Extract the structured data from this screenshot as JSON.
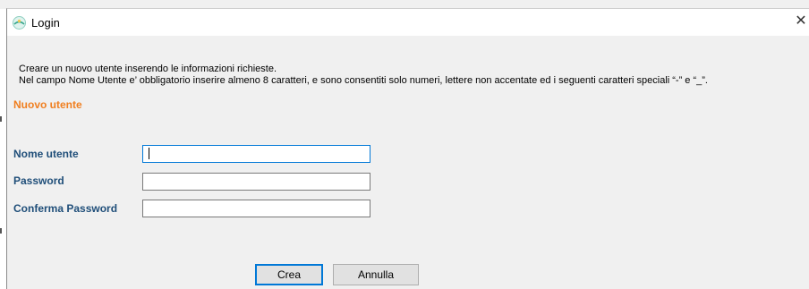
{
  "window": {
    "title": "Login",
    "close_glyph": "✕",
    "app_icon": "app-logo-icon"
  },
  "instructions": {
    "line1": "Creare un nuovo utente inserendo le informazioni richieste.",
    "line2": "Nel campo Nome Utente e’ obbligatorio inserire almeno 8 caratteri, e sono consentiti solo numeri, lettere non accentate ed i seguenti caratteri speciali “-” e “_”."
  },
  "section": {
    "title": "Nuovo utente"
  },
  "form": {
    "username_label": "Nome utente",
    "username_value": "",
    "password_label": "Password",
    "password_value": "",
    "confirm_label": "Conferma Password",
    "confirm_value": ""
  },
  "buttons": {
    "create_label": "Crea",
    "cancel_label": "Annulla"
  },
  "colors": {
    "section_title": "#f07f20",
    "field_label": "#1f4e79",
    "focus_border": "#0078d7"
  }
}
